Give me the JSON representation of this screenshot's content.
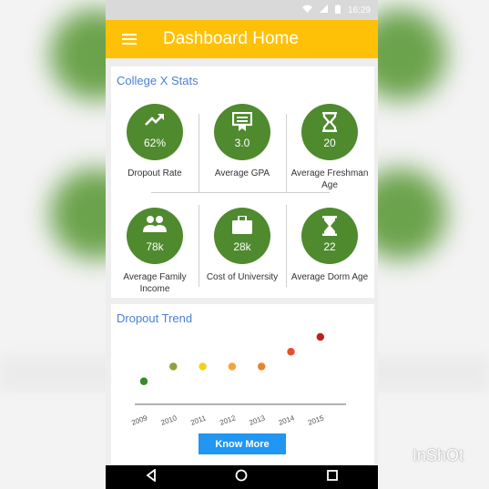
{
  "statusbar": {
    "time": "16:29"
  },
  "appbar": {
    "title": "Dashboard Home"
  },
  "stats": {
    "title": "College X  Stats",
    "tiles": [
      {
        "value": "62%",
        "label": "Dropout Rate",
        "icon": "trending-up-icon"
      },
      {
        "value": "3.0",
        "label": "Average GPA",
        "icon": "certificate-icon"
      },
      {
        "value": "20",
        "label": "Average Freshman Age",
        "icon": "hourglass-icon"
      },
      {
        "value": "78k",
        "label": "Average Family Income",
        "icon": "people-icon"
      },
      {
        "value": "28k",
        "label": "Cost of University",
        "icon": "briefcase-icon"
      },
      {
        "value": "22",
        "label": "Average Dorm Age",
        "icon": "hourglass-filled-icon"
      }
    ]
  },
  "trend": {
    "title": "Dropout Trend",
    "button_label": "Know More"
  },
  "chart_data": {
    "type": "scatter",
    "title": "Dropout Trend",
    "categories": [
      "2009",
      "2010",
      "2011",
      "2012",
      "2013",
      "2014",
      "2015"
    ],
    "values": [
      1,
      2,
      2,
      2,
      2,
      3,
      4
    ],
    "point_colors": [
      "#3a8a2a",
      "#8ca33a",
      "#f2d21a",
      "#f4a33a",
      "#e8842a",
      "#e5502a",
      "#c0201a"
    ],
    "grid": false,
    "xlabel": "",
    "ylabel": ""
  },
  "watermark": "InShOt"
}
